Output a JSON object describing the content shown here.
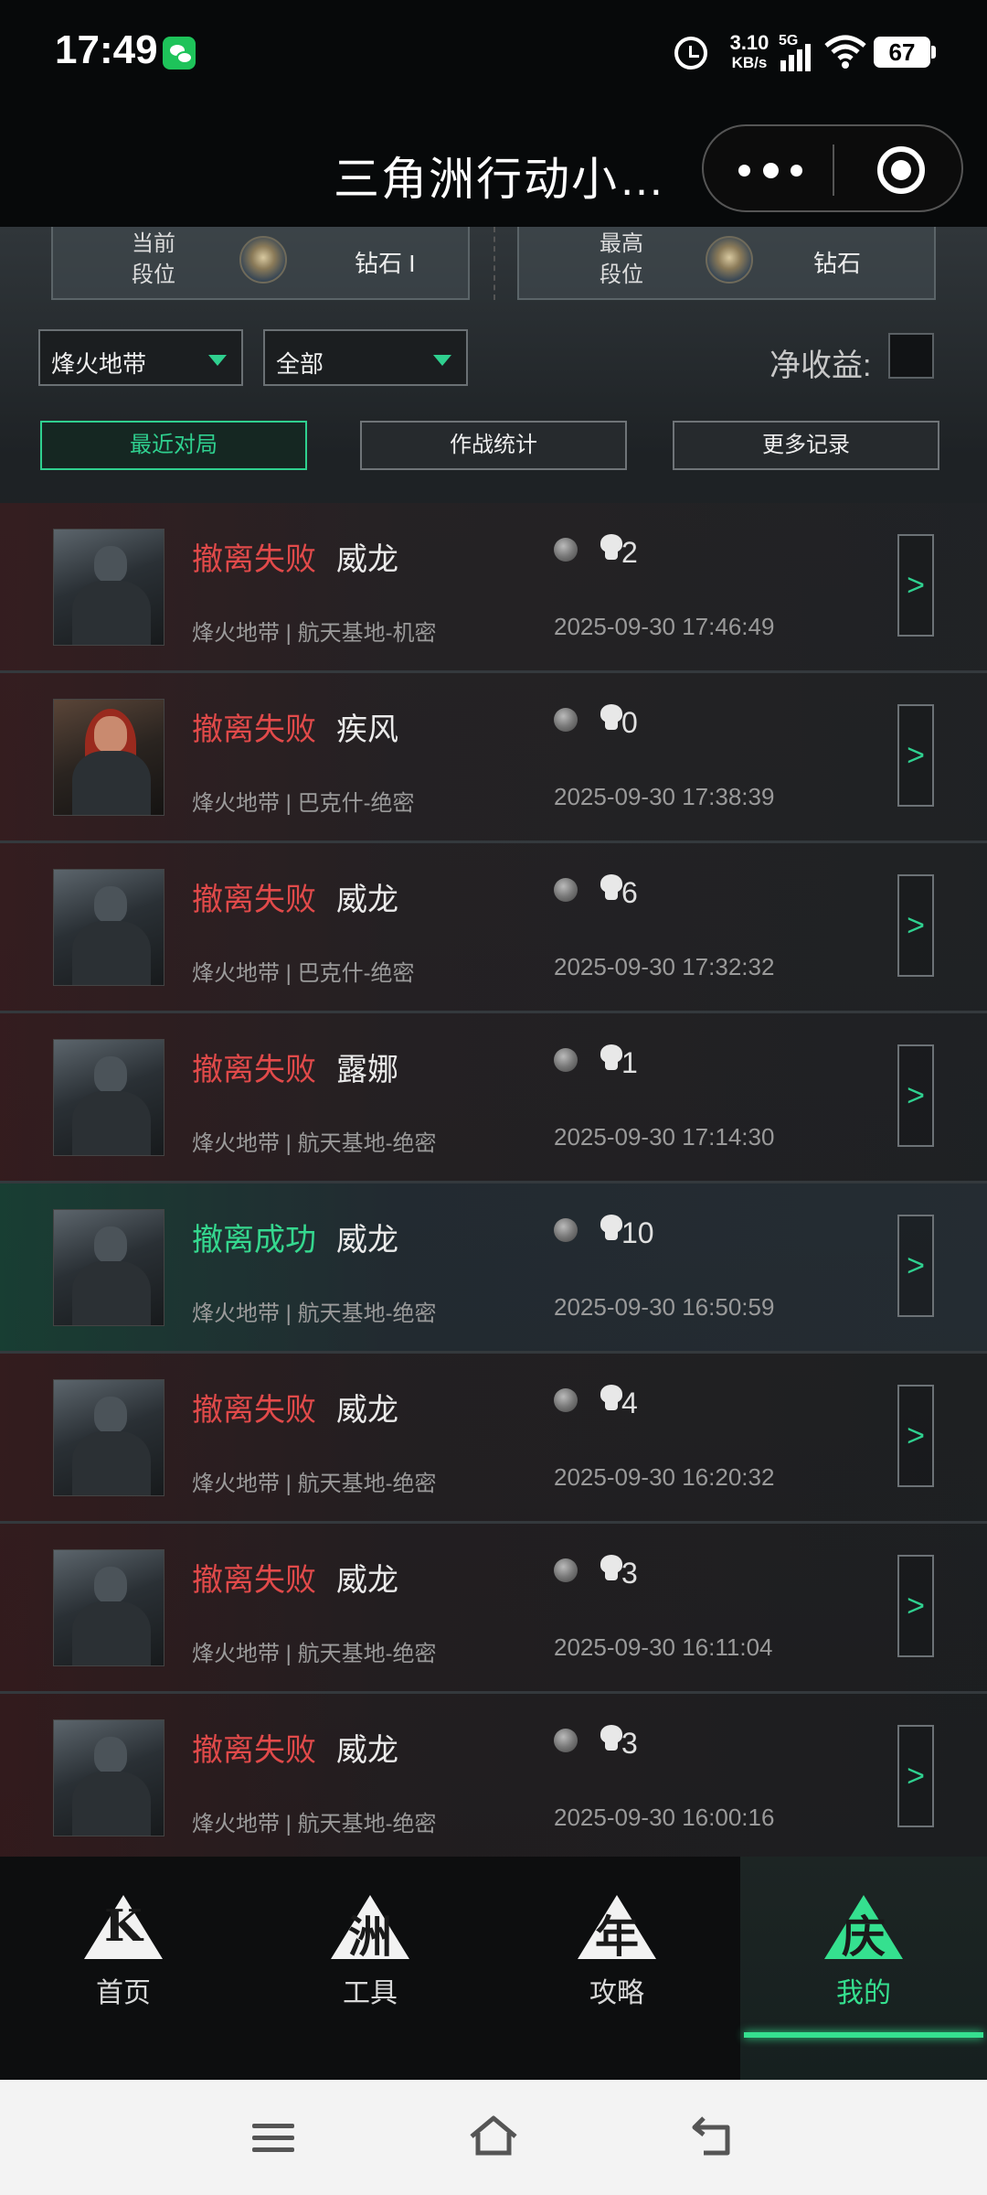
{
  "status_bar": {
    "time": "17:49",
    "net_speed_value": "3.10",
    "net_speed_unit": "KB/s",
    "signal_label": "5G",
    "battery": "67"
  },
  "header": {
    "title": "三角洲行动小…"
  },
  "rank": {
    "current_label": "当前\n段位",
    "current_value": "钻石 I",
    "highest_label": "最高\n段位",
    "highest_value": "钻石"
  },
  "filters": {
    "mode_value": "烽火地带",
    "scope_value": "全部",
    "net_profit_label": "净收益:"
  },
  "tabs": [
    {
      "label": "最近对局"
    },
    {
      "label": "作战统计"
    },
    {
      "label": "更多记录"
    }
  ],
  "matches": [
    {
      "result": "撤离失败",
      "operator": "威龙",
      "kills": "2",
      "map": "烽火地带 | 航天基地-机密",
      "time": "2025-09-30 17:46:49",
      "detail": ">"
    },
    {
      "result": "撤离失败",
      "operator": "疾风",
      "kills": "0",
      "map": "烽火地带 | 巴克什-绝密",
      "time": "2025-09-30 17:38:39",
      "detail": ">"
    },
    {
      "result": "撤离失败",
      "operator": "威龙",
      "kills": "6",
      "map": "烽火地带 | 巴克什-绝密",
      "time": "2025-09-30 17:32:32",
      "detail": ">"
    },
    {
      "result": "撤离失败",
      "operator": "露娜",
      "kills": "1",
      "map": "烽火地带 | 航天基地-绝密",
      "time": "2025-09-30 17:14:30",
      "detail": ">"
    },
    {
      "result": "撤离成功",
      "operator": "威龙",
      "kills": "10",
      "map": "烽火地带 | 航天基地-绝密",
      "time": "2025-09-30 16:50:59",
      "detail": ">"
    },
    {
      "result": "撤离失败",
      "operator": "威龙",
      "kills": "4",
      "map": "烽火地带 | 航天基地-绝密",
      "time": "2025-09-30 16:20:32",
      "detail": ">"
    },
    {
      "result": "撤离失败",
      "operator": "威龙",
      "kills": "3",
      "map": "烽火地带 | 航天基地-绝密",
      "time": "2025-09-30 16:11:04",
      "detail": ">"
    },
    {
      "result": "撤离失败",
      "operator": "威龙",
      "kills": "3",
      "map": "烽火地带 | 航天基地-绝密",
      "time": "2025-09-30 16:00:16",
      "detail": ">"
    }
  ],
  "bottom_nav": [
    {
      "label": "首页",
      "glyph": "K",
      "icon": "home-logo-icon"
    },
    {
      "label": "工具",
      "glyph": "洲",
      "icon": "tools-logo-icon"
    },
    {
      "label": "攻略",
      "glyph": "年",
      "icon": "guide-logo-icon"
    },
    {
      "label": "我的",
      "glyph": "庆",
      "icon": "profile-logo-icon"
    }
  ],
  "colors": {
    "accent_green": "#35e08f",
    "fail_red": "#e14a4a",
    "background": "#0b0c0d"
  }
}
